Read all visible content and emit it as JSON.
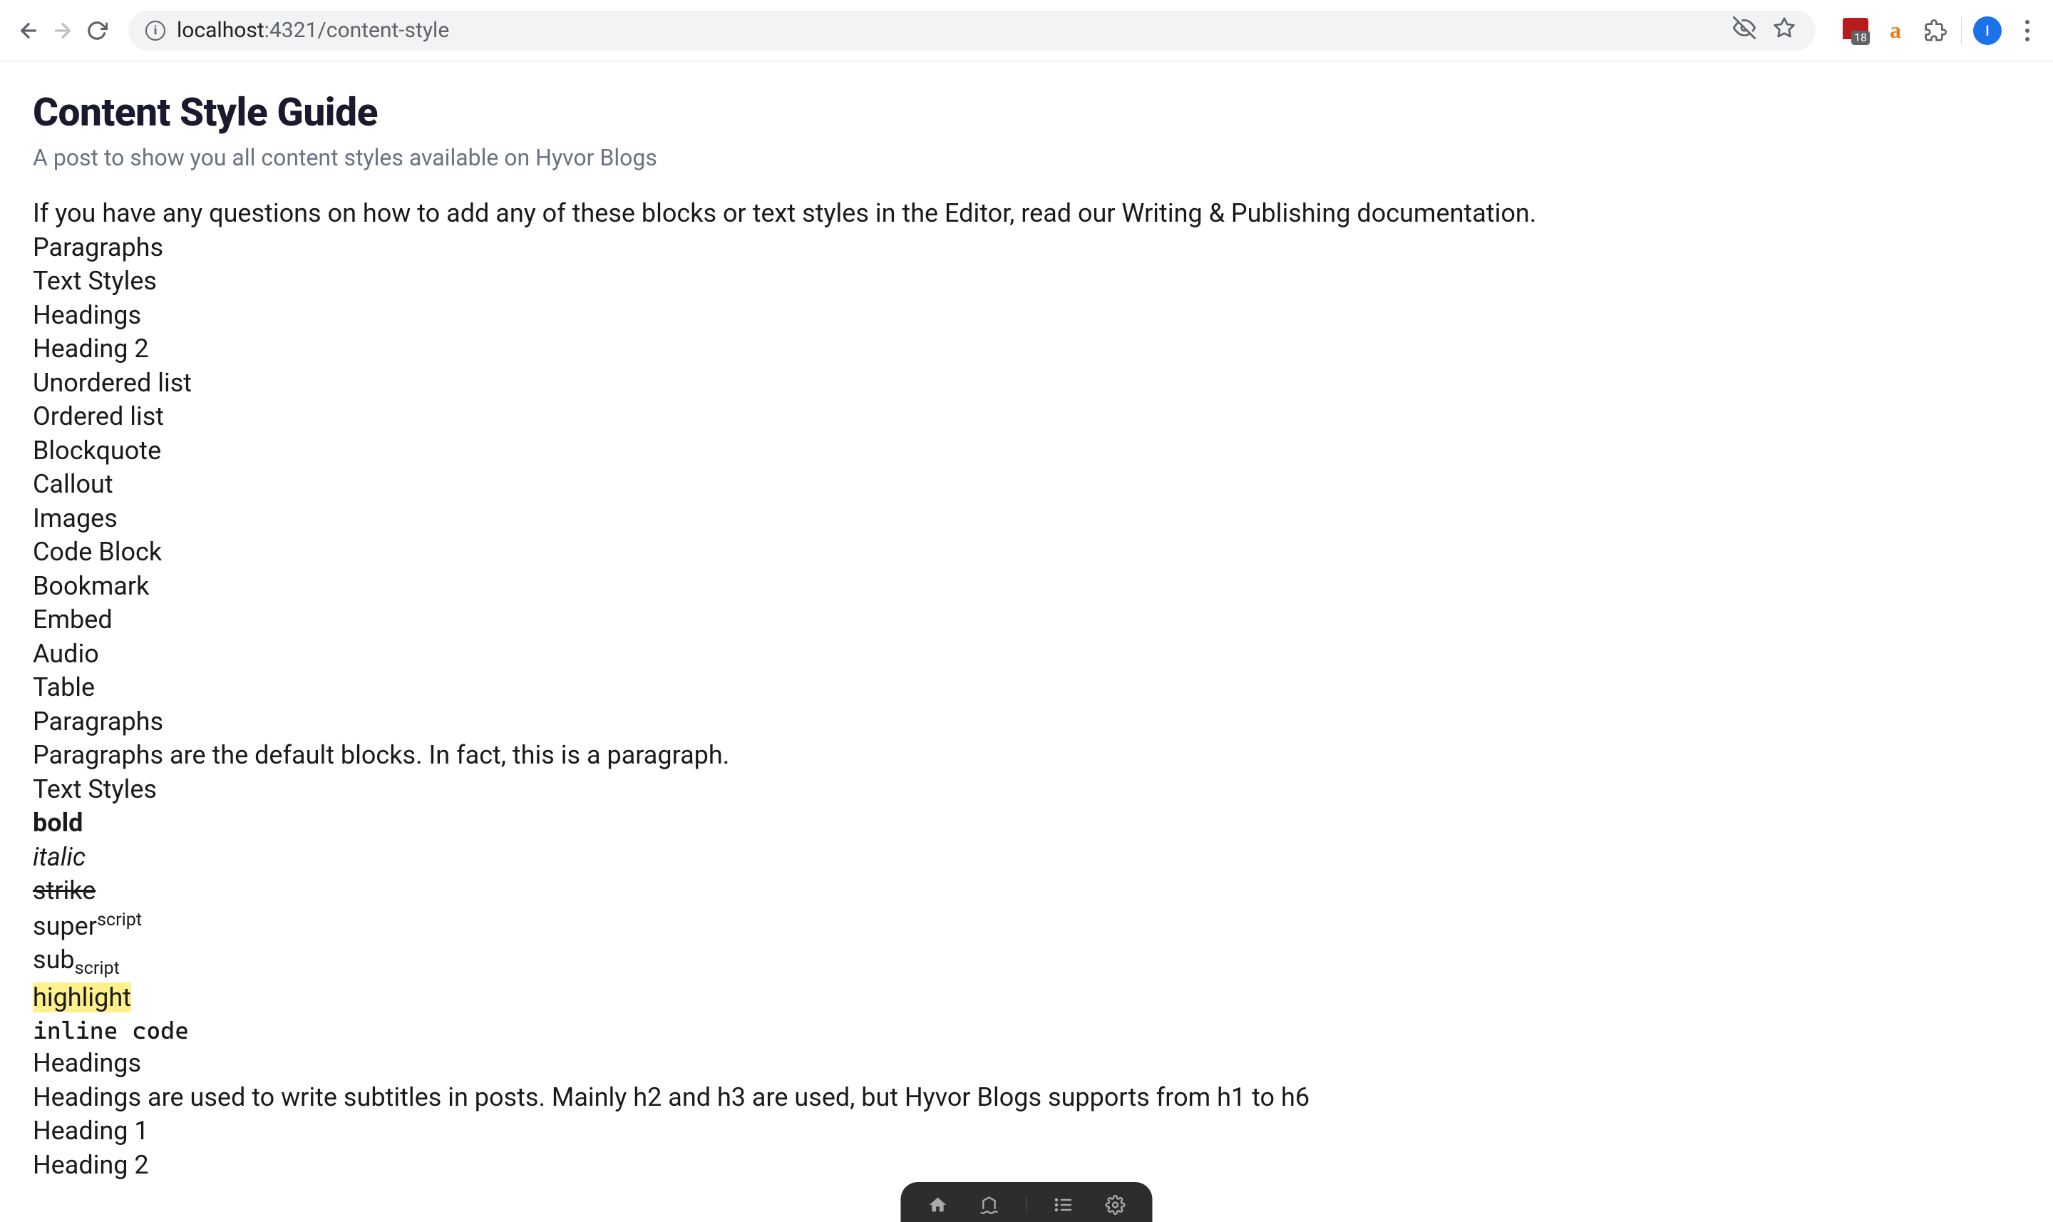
{
  "browser": {
    "url_host": "localhost",
    "url_port": ":4321",
    "url_path": "/content-style",
    "ext_badge_count": "18",
    "ext_a_letter": "a",
    "avatar_letter": "I"
  },
  "page": {
    "title": "Content Style Guide",
    "subtitle": "A post to show you all content styles available on Hyvor Blogs",
    "intro": "If you have any questions on how to add any of these blocks or text styles in the Editor, read our Writing & Publishing documentation.",
    "toc": [
      "Paragraphs",
      "Text Styles",
      "Headings",
      "Heading 2",
      "Unordered list",
      "Ordered list",
      "Blockquote",
      "Callout",
      "Images",
      "Code Block",
      "Bookmark",
      "Embed",
      "Audio",
      "Table"
    ],
    "sections": {
      "paragraphs_heading": "Paragraphs",
      "paragraphs_text": "Paragraphs are the default blocks. In fact, this is a paragraph.",
      "textstyles_heading": "Text Styles",
      "bold": "bold",
      "italic": "italic",
      "strike": "strike",
      "super_base": "super",
      "super_script": "script",
      "sub_base": "sub",
      "sub_script": "script",
      "highlight": "highlight",
      "inline_code": "inline code",
      "headings_heading": "Headings",
      "headings_text": "Headings are used to write subtitles in posts. Mainly h2 and h3 are used, but Hyvor Blogs supports from h1 to h6",
      "heading_1": "Heading 1",
      "heading_2": "Heading 2"
    }
  }
}
